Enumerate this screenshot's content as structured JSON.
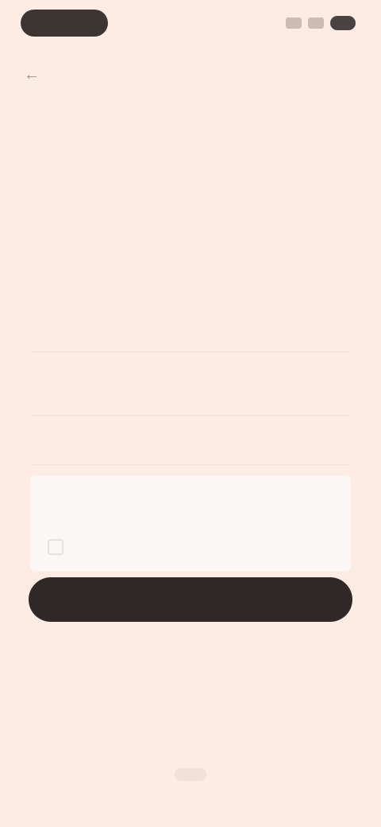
{
  "status_bar": {
    "time": "",
    "icons": [
      "signal-icon",
      "wifi-icon",
      "battery-icon"
    ]
  },
  "back": {
    "icon": "arrow-left-icon",
    "label": "←"
  },
  "content": {
    "heading": "",
    "description": "",
    "note": ""
  },
  "fields": [
    {
      "label": ""
    },
    {
      "label": ""
    },
    {
      "label": ""
    }
  ],
  "card": {
    "title": "",
    "link": ""
  },
  "primary_button": {
    "label": ""
  },
  "secondary_text": "",
  "colors": {
    "background": "#fcece4",
    "button": "#2f2826",
    "card": "#fbf8f6"
  }
}
